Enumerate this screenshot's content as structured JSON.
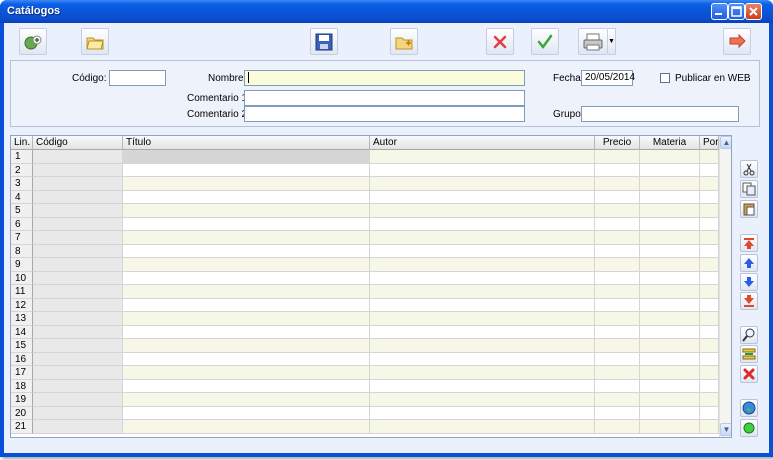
{
  "window": {
    "title": "Catálogos"
  },
  "form": {
    "codigo_label": "Código:",
    "codigo_value": "",
    "nombre_label": "Nombre:",
    "nombre_value": "",
    "fecha_label": "Fecha:",
    "fecha_value": "20/05/2014",
    "publicar_label": "Publicar en WEB",
    "publicar_checked": false,
    "comentario1_label": "Comentario 1:",
    "comentario1_value": "",
    "comentario2_label": "Comentario 2:",
    "comentario2_value": "",
    "grupo_label": "Grupo:",
    "grupo_value": ""
  },
  "grid": {
    "columns": [
      "Lin.",
      "Código",
      "Título",
      "Autor",
      "Precio",
      "Materia",
      "Por."
    ],
    "rows": [
      "1",
      "2",
      "3",
      "4",
      "5",
      "6",
      "7",
      "8",
      "9",
      "10",
      "11",
      "12",
      "13",
      "14",
      "15",
      "16",
      "17",
      "18",
      "19",
      "20",
      "21"
    ]
  },
  "toolbar": [
    "add-icon",
    "open-folder-icon",
    "save-icon",
    "new-folder-icon",
    "cancel-icon",
    "accept-icon",
    "print-icon",
    "exit-icon"
  ],
  "sidebar_tools": [
    "cut-icon",
    "copy-icon",
    "paste-icon",
    "move-top-icon",
    "move-up-icon",
    "move-down-icon",
    "move-bottom-icon",
    "search-icon",
    "insert-row-icon",
    "delete-row-icon",
    "globe-icon",
    "status-green-icon"
  ],
  "colors": {
    "title_bar": "#0a55d8",
    "client_bg": "#eaf0fc",
    "grid_alt_row": "#f6f7e6",
    "field_yellow": "#fafcdc"
  }
}
